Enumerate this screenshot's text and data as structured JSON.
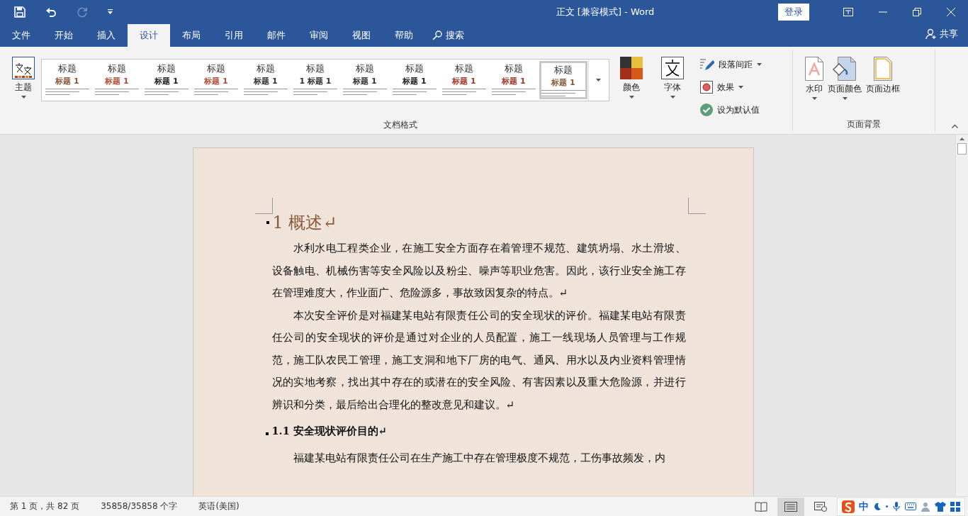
{
  "window": {
    "title": "正文 [兼容模式]  -  Word",
    "sign_in": "登录"
  },
  "quick_access": [
    {
      "kind": "save",
      "disabled": false
    },
    {
      "kind": "undo",
      "disabled": false
    },
    {
      "kind": "redo",
      "disabled": true
    },
    {
      "kind": "customize",
      "disabled": false
    }
  ],
  "tabs": [
    {
      "label": "文件",
      "selected": false
    },
    {
      "label": "开始",
      "selected": false
    },
    {
      "label": "插入",
      "selected": false
    },
    {
      "label": "设计",
      "selected": true
    },
    {
      "label": "布局",
      "selected": false
    },
    {
      "label": "引用",
      "selected": false
    },
    {
      "label": "邮件",
      "selected": false
    },
    {
      "label": "审阅",
      "selected": false
    },
    {
      "label": "视图",
      "selected": false
    },
    {
      "label": "帮助",
      "selected": false
    }
  ],
  "search": "搜索",
  "share": "共享",
  "ribbon": {
    "theme_button": "主题",
    "styles": [
      {
        "title": "标题",
        "heading": "标题 1",
        "color": "#8a5a3a",
        "selected": false
      },
      {
        "title": "标题",
        "heading": "标题 1",
        "color": "#b0503a",
        "selected": false
      },
      {
        "title": "标题",
        "heading": "标题 1",
        "color": "#222222",
        "selected": false
      },
      {
        "title": "标题",
        "heading": "标题 1",
        "color": "#b0503a",
        "selected": false
      },
      {
        "title": "标题",
        "heading": "标题 1",
        "color": "#333333",
        "selected": false
      },
      {
        "title": "标题",
        "heading": "1  标题 1",
        "color": "#333333",
        "selected": false
      },
      {
        "title": "标题",
        "heading": "标题 1",
        "color": "#333333",
        "selected": false
      },
      {
        "title": "标题",
        "heading": "标题 1",
        "color": "#222222",
        "selected": false
      },
      {
        "title": "标题",
        "heading": "标题 1",
        "color": "#a03a2a",
        "selected": false
      },
      {
        "title": "标题",
        "heading": "标题 1",
        "color": "#a03a2a",
        "selected": false
      },
      {
        "title": "标题",
        "heading": "标题 1",
        "color": "#8a5a3a",
        "selected": true
      }
    ],
    "colors_button": "颜色",
    "fonts_button": "字体",
    "small_buttons": [
      {
        "label": "段落间距",
        "kind": "spacing",
        "dropdown": true
      },
      {
        "label": "效果",
        "kind": "effects",
        "dropdown": true
      },
      {
        "label": "设为默认值",
        "kind": "default",
        "dropdown": false
      }
    ],
    "group_1": "文档格式",
    "page_buttons": [
      {
        "label": "水印",
        "kind": "watermark",
        "dropdown": true
      },
      {
        "label": "页面颜色",
        "kind": "page-color",
        "dropdown": true
      },
      {
        "label": "页面边框",
        "kind": "page-border",
        "dropdown": false
      }
    ],
    "group_2": "页面背景"
  },
  "document": {
    "blocks": [
      {
        "kind": "heading1",
        "text": "1  概述↵"
      },
      {
        "kind": "paragraph",
        "text": "水利水电工程类企业，在施工安全方面存在着管理不规范、建筑坍塌、水土滑坡、设备触电、机械伤害等安全风险以及粉尘、噪声等职业危害。因此，该行业安全施工存在管理难度大，作业面广、危险源多，事故致因复杂的特点。↵"
      },
      {
        "kind": "paragraph",
        "text": "本次安全评价是对福建某电站有限责任公司的安全现状的评价。福建某电站有限责任公司的安全现状的评价是通过对企业的人员配置，施工一线现场人员管理与工作规范，施工队农民工管理，施工支洞和地下厂房的电气、通风、用水以及内业资料管理情况的实地考察，找出其中存在的或潜在的安全风险、有害因素以及重大危险源，并进行辨识和分类，最后给出合理化的整改意见和建议。↵"
      },
      {
        "kind": "heading2",
        "text": "1.1 安全现状评价目的↵"
      },
      {
        "kind": "paragraph",
        "text": "福建某电站有限责任公司在生产施工中存在管理极度不规范，工伤事故频发，内"
      }
    ]
  },
  "status_bar": {
    "page": "第 1 页，共 82 页",
    "words": "35858/35858 个字",
    "language": "英语(美国)",
    "views": [
      {
        "kind": "read",
        "selected": false
      },
      {
        "kind": "print",
        "selected": true
      },
      {
        "kind": "web",
        "selected": false
      }
    ],
    "ime": "中"
  }
}
